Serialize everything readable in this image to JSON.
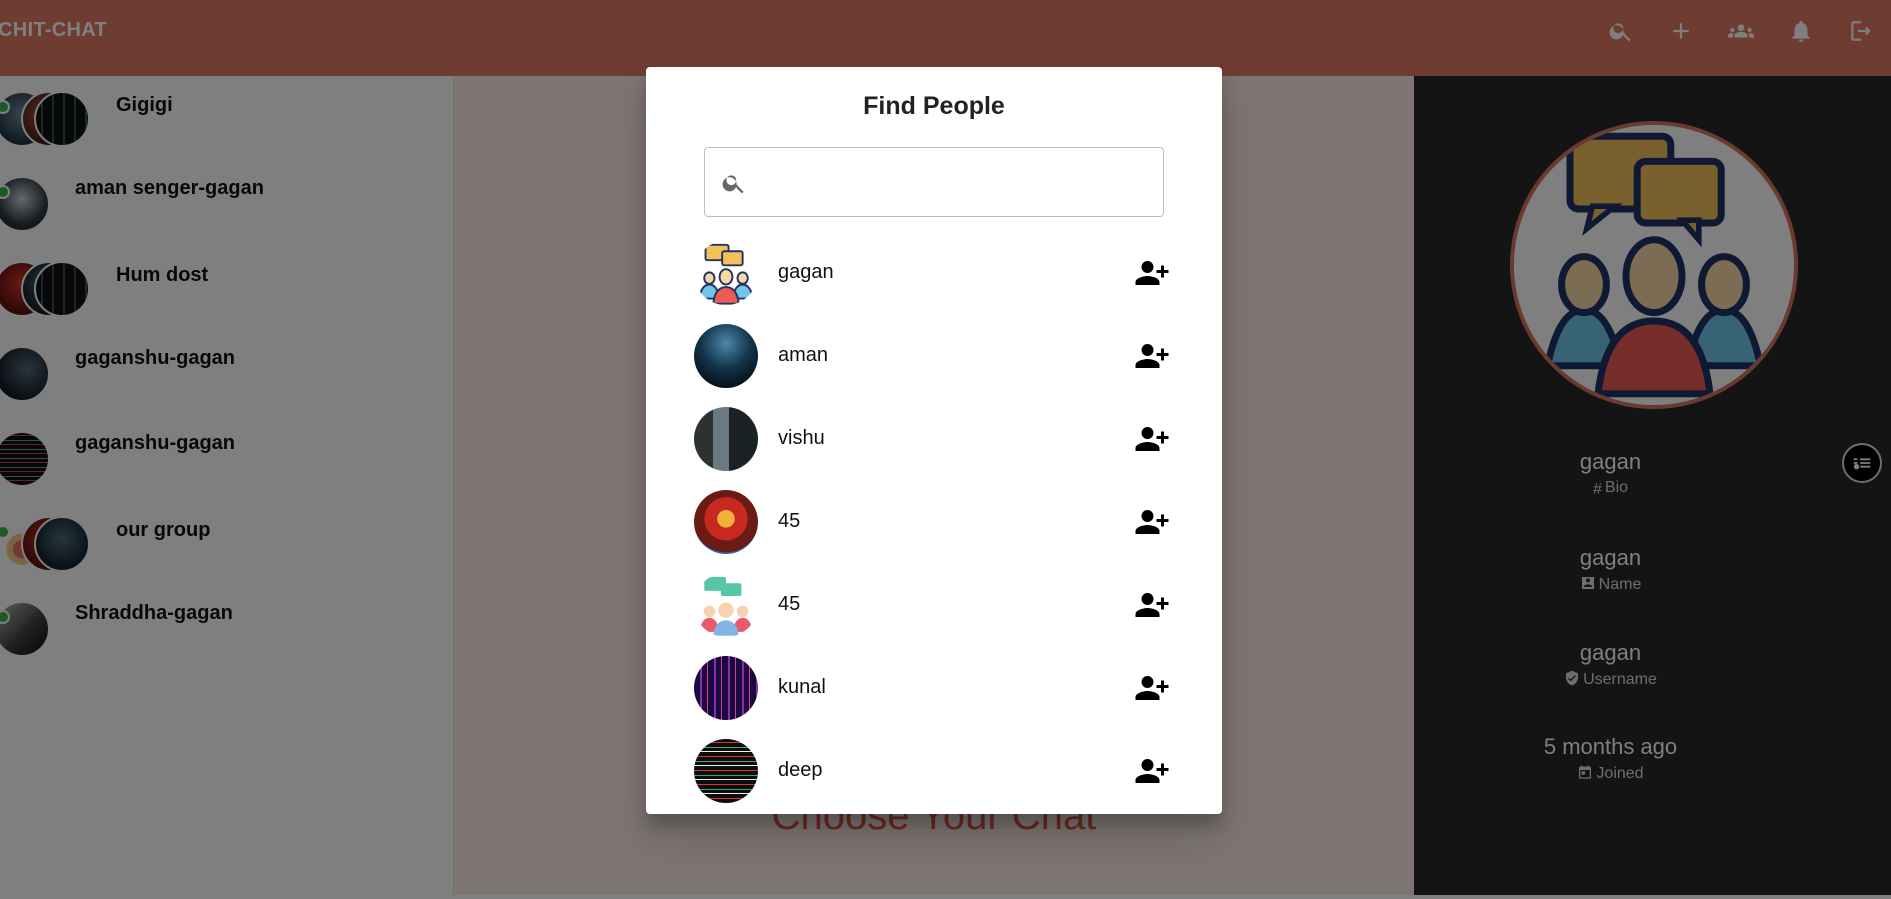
{
  "app": {
    "brand": "CHIT-CHAT",
    "toolbar_icons": [
      "search-icon",
      "add-icon",
      "groups-icon",
      "notifications-icon",
      "logout-icon"
    ]
  },
  "sidebar": {
    "chats": [
      {
        "name": "Gigigi",
        "type": "group"
      },
      {
        "name": "aman senger-gagan",
        "type": "direct"
      },
      {
        "name": "Hum dost",
        "type": "group"
      },
      {
        "name": "gaganshu-gagan",
        "type": "direct"
      },
      {
        "name": "gaganshu-gagan",
        "type": "direct"
      },
      {
        "name": "our group",
        "type": "group"
      },
      {
        "name": "Shraddha-gagan",
        "type": "direct"
      }
    ]
  },
  "center": {
    "placeholder": "Choose Your Chat"
  },
  "profile": {
    "fields": [
      {
        "value": "gagan",
        "label": "Bio",
        "icon": "hash-icon"
      },
      {
        "value": "gagan",
        "label": "Name",
        "icon": "contact-card-icon"
      },
      {
        "value": "gagan",
        "label": "Username",
        "icon": "verified-user-icon"
      },
      {
        "value": "5 months ago",
        "label": "Joined",
        "icon": "calendar-icon"
      }
    ]
  },
  "dialog": {
    "title": "Find People",
    "search_value": "",
    "search_placeholder": "",
    "people": [
      {
        "name": "gagan",
        "avatar": "group-chat-illustration"
      },
      {
        "name": "aman",
        "avatar": "photo"
      },
      {
        "name": "vishu",
        "avatar": "photo"
      },
      {
        "name": "45",
        "avatar": "photo"
      },
      {
        "name": "45",
        "avatar": "group-chat-illustration"
      },
      {
        "name": "kunal",
        "avatar": "photo"
      },
      {
        "name": "deep",
        "avatar": "photo"
      }
    ]
  },
  "colors": {
    "appbar": "#df7864",
    "center_bg": "#fbeae5",
    "accent_text": "#d9553e",
    "panel_bg": "#282828",
    "online": "#3ab34a"
  }
}
